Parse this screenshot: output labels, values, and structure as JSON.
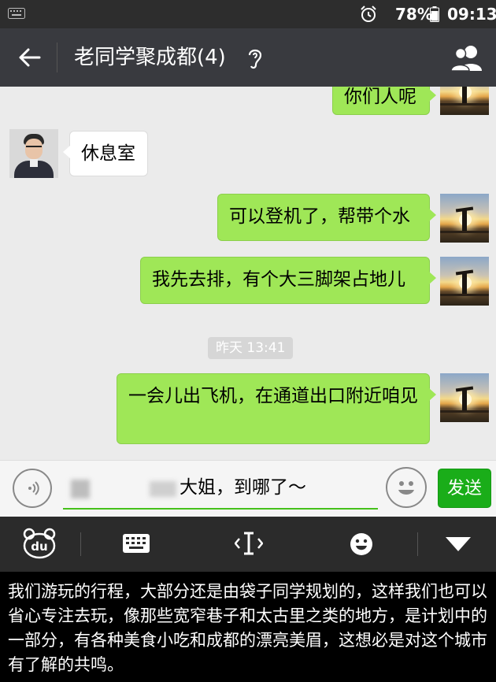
{
  "status_bar": {
    "battery": "78%",
    "time": "09:13"
  },
  "header": {
    "title": "老同学聚成都(4)"
  },
  "chat": {
    "messages": [
      {
        "side": "right",
        "text": "你们人呢"
      },
      {
        "side": "left",
        "text": "休息室"
      },
      {
        "side": "right",
        "text": "可以登机了，帮带个水"
      },
      {
        "side": "right",
        "text": "我先去排，有个大三脚架占地儿"
      },
      {
        "side": "right",
        "text": "一会儿出飞机，在通道出口附近咱见"
      }
    ],
    "timestamp": "昨天 13:41"
  },
  "input_bar": {
    "draft_text": "大姐，到哪了～",
    "send_label": "发送"
  },
  "keyboard_toolbar": {
    "icons": [
      "du-keyboard-logo-icon",
      "keyboard-icon",
      "cursor-icon",
      "emoji-icon",
      "collapse-keyboard-icon"
    ]
  },
  "caption": {
    "text": "我们游玩的行程，大部分还是由袋子同学规划的，这样我们也可以省心专注去玩，像那些宽窄巷子和太古里之类的地方，是计划中的一部分，有各种美食小吃和成都的漂亮美眉，这想必是对这个城市有了解的共鸣。"
  },
  "colors": {
    "status_bar": "#2d2d2d",
    "title_bar": "#393a3f",
    "chat_background": "#ebebeb",
    "outgoing_bubble": "#9fe757",
    "incoming_bubble": "#ffffff",
    "send_button": "#1aad19",
    "input_underline": "#45c01a",
    "keyboard_bar": "#2b2b2b"
  }
}
